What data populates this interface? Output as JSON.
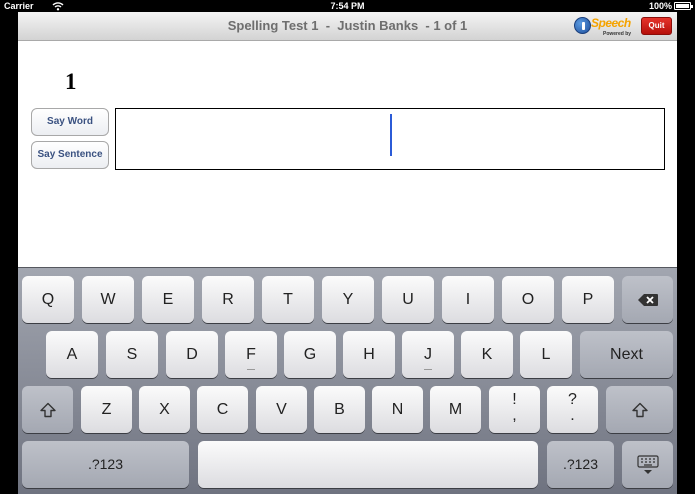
{
  "status_bar": {
    "carrier": "Carrier",
    "time": "7:54 PM",
    "battery": "100%"
  },
  "nav": {
    "title": "Spelling Test 1  -  Justin Banks  - 1 of 1",
    "brand_word": "Speech",
    "brand_sub": "Powered by",
    "quit_label": "Quit"
  },
  "content": {
    "word_number": "1",
    "say_word_label": "Say Word",
    "say_sentence_label": "Say Sentence",
    "answer_value": ""
  },
  "keyboard": {
    "row1": [
      "Q",
      "W",
      "E",
      "R",
      "T",
      "Y",
      "U",
      "I",
      "O",
      "P"
    ],
    "row2": [
      "A",
      "S",
      "D",
      "F",
      "G",
      "H",
      "J",
      "K",
      "L"
    ],
    "row3": [
      "Z",
      "X",
      "C",
      "V",
      "B",
      "N",
      "M"
    ],
    "next_label": "Next",
    "exclaim_top": "!",
    "exclaim_bottom": ",",
    "question_top": "?",
    "question_bottom": ".",
    "numbers_label": ".?123"
  },
  "colors": {
    "quit_red": "#d11a12",
    "cursor_blue": "#2b5bd7",
    "side_button_text": "#3a5180",
    "brand_orange": "#f5a300"
  },
  "icons": [
    "wifi-icon",
    "battery-icon",
    "speech-logo-icon",
    "delete-icon",
    "shift-icon",
    "keyboard-dismiss-icon"
  ]
}
